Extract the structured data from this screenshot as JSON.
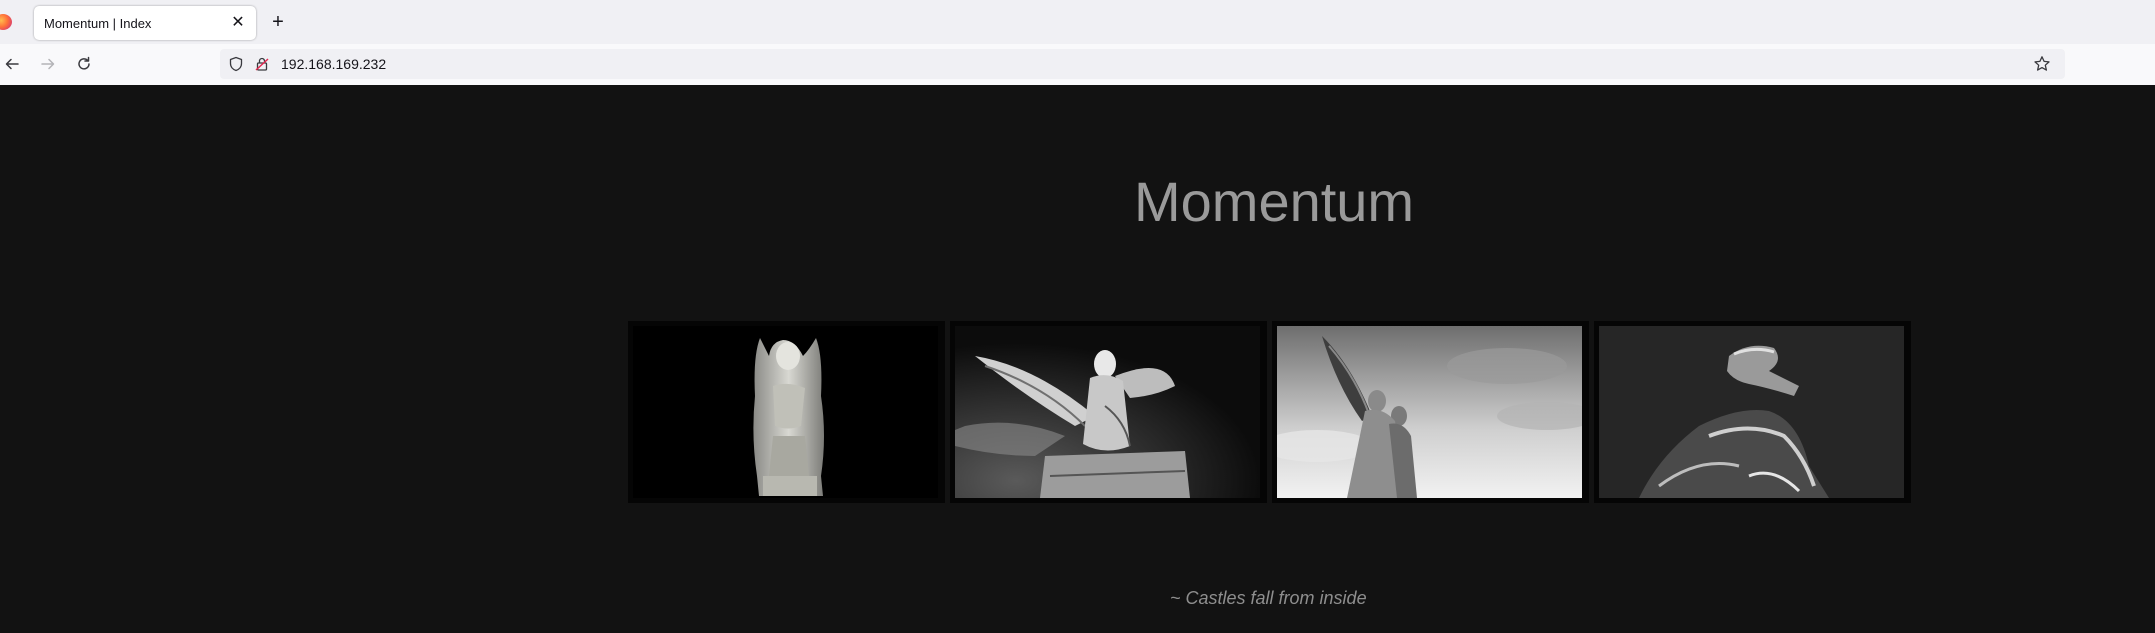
{
  "browser": {
    "tab_title": "Momentum | Index",
    "tab_close": "✕",
    "new_tab": "+",
    "url": "192.168.169.232"
  },
  "icons": {
    "back": "back-arrow-icon",
    "forward": "forward-arrow-icon",
    "reload": "reload-icon",
    "shield": "shield-icon",
    "lock": "insecure-lock-icon",
    "bookmark": "star-icon"
  },
  "page": {
    "heading": "Momentum",
    "gallery": [
      {
        "name": "gargoyle-statue-photo"
      },
      {
        "name": "winged-angel-statue-photo"
      },
      {
        "name": "angels-sky-statue-photo"
      },
      {
        "name": "dark-angel-statue-photo"
      }
    ],
    "quote": "~ Castles fall from inside"
  },
  "colors": {
    "page_background": "#121212",
    "heading": "#9a9a9a",
    "quote": "#8e8e8e"
  }
}
